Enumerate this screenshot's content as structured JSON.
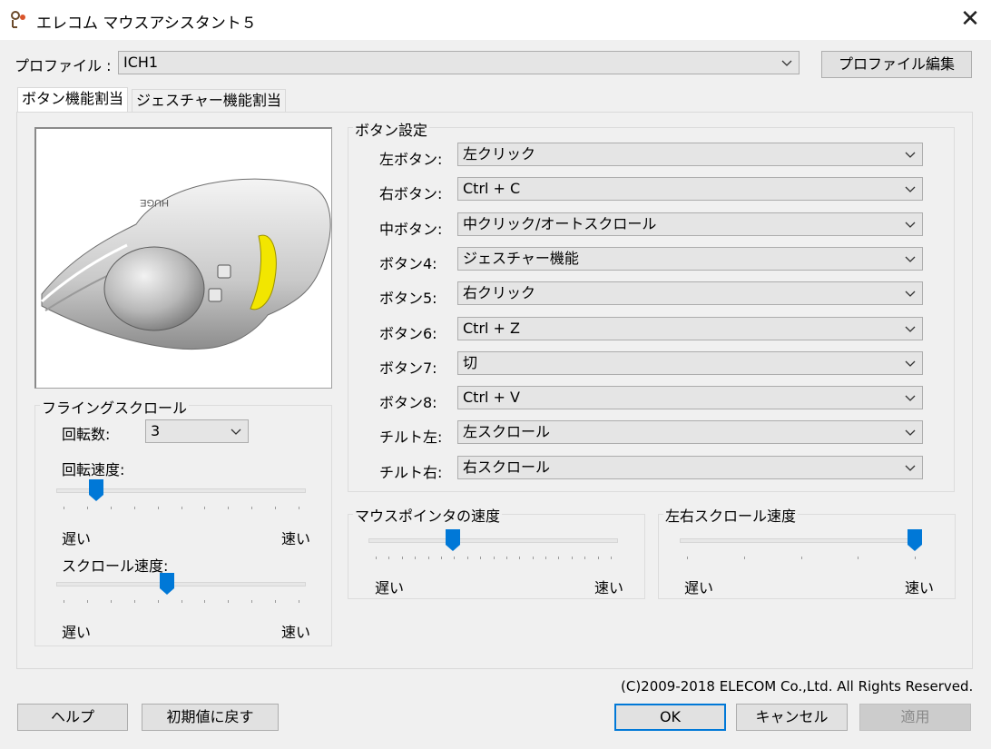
{
  "window": {
    "title": "エレコム マウスアシスタント５"
  },
  "profile": {
    "label": "プロファイル :",
    "value": "ICH1",
    "edit_button": "プロファイル編集"
  },
  "tabs": [
    {
      "label": "ボタン機能割当"
    },
    {
      "label": "ジェスチャー機能割当"
    }
  ],
  "mouse_image": {
    "brand_text": "HUGE"
  },
  "flying_scroll": {
    "title": "フライングスクロール",
    "rotation_count_label": "回転数:",
    "rotation_count_value": "3",
    "rotation_speed_label": "回転速度:",
    "rotation_speed_level": 0.14,
    "scroll_speed_label": "スクロール速度:",
    "scroll_speed_level": 0.44,
    "slow": "遅い",
    "fast": "速い"
  },
  "button_settings": {
    "title": "ボタン設定",
    "rows": [
      {
        "label": "左ボタン:",
        "value": "左クリック"
      },
      {
        "label": "右ボタン:",
        "value": "Ctrl + C"
      },
      {
        "label": "中ボタン:",
        "value": "中クリック/オートスクロール"
      },
      {
        "label": "ボタン4:",
        "value": "ジェスチャー機能"
      },
      {
        "label": "ボタン5:",
        "value": "右クリック"
      },
      {
        "label": "ボタン6:",
        "value": "Ctrl + Z"
      },
      {
        "label": "ボタン7:",
        "value": "切"
      },
      {
        "label": "ボタン8:",
        "value": "Ctrl + V"
      },
      {
        "label": "チルト左:",
        "value": "左スクロール"
      },
      {
        "label": "チルト右:",
        "value": "右スクロール"
      }
    ]
  },
  "pointer_speed": {
    "title": "マウスポインタの速度",
    "level": 0.33,
    "slow": "遅い",
    "fast": "速い"
  },
  "hscroll_speed": {
    "title": "左右スクロール速度",
    "level": 1.0,
    "slow": "遅い",
    "fast": "速い"
  },
  "copyright": "(C)2009-2018 ELECOM Co.,Ltd. All Rights Reserved.",
  "footer": {
    "help": "ヘルプ",
    "reset": "初期値に戻す",
    "ok": "OK",
    "cancel": "キャンセル",
    "apply": "適用"
  },
  "colors": {
    "accent": "#0078d7",
    "highlight": "#f2e600"
  }
}
